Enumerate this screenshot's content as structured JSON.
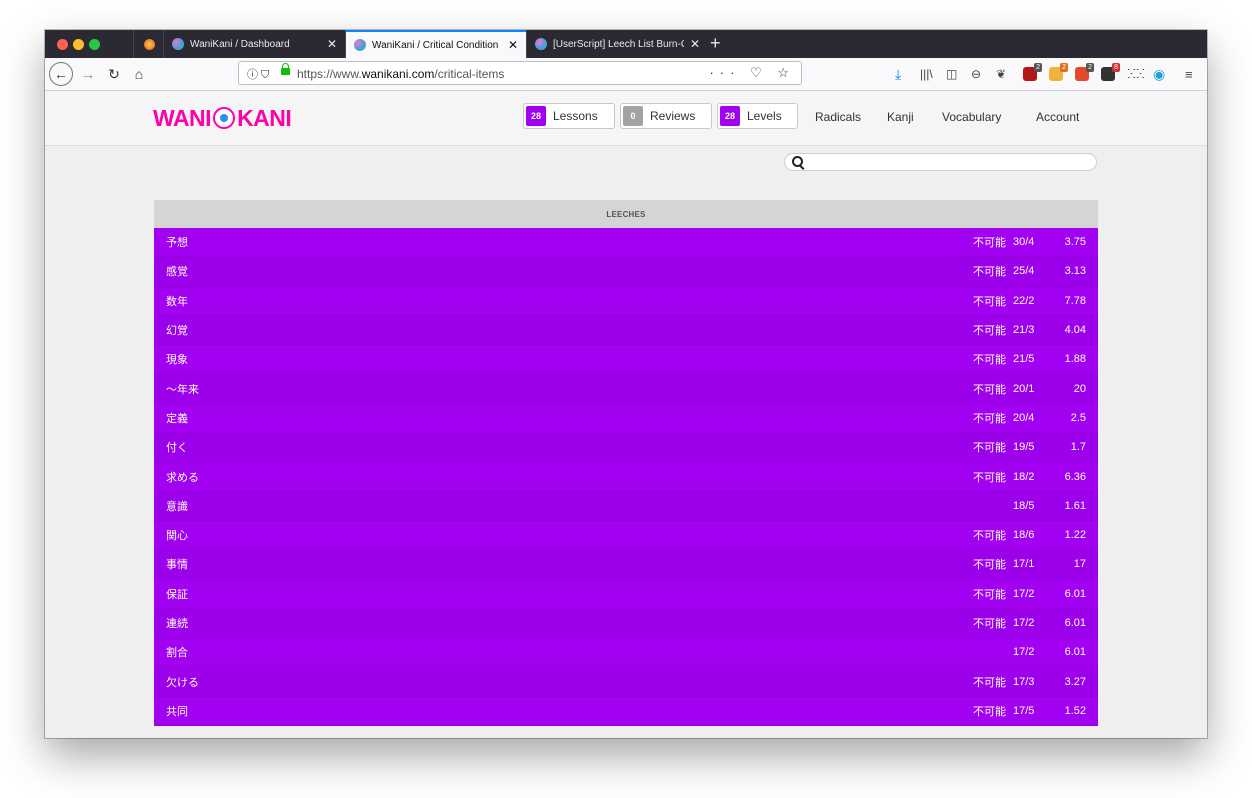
{
  "browser": {
    "tabs": [
      {
        "title": "WaniKani / Dashboard",
        "close": "✕"
      },
      {
        "title": "WaniKani / Critical Condition Ite",
        "close": "✕"
      },
      {
        "title": "[UserScript] Leech List Burn-O",
        "close": "✕"
      }
    ],
    "new_tab": "+",
    "url_info": "ⓘ ⛉",
    "url_prefix": "https://www.",
    "url_domain": "wanikani.com",
    "url_path": "/critical-items",
    "url_actions": "··· ♡ ☆",
    "badges": [
      "2",
      "2",
      "2",
      "8"
    ]
  },
  "site": {
    "logo_left": "WANI",
    "logo_right": "KANI",
    "lessons": {
      "count": "28",
      "label": "Lessons"
    },
    "reviews": {
      "count": "0",
      "label": "Reviews"
    },
    "levels": {
      "count": "28",
      "label": "Levels"
    },
    "nav": {
      "radicals": "Radicals",
      "kanji": "Kanji",
      "vocabulary": "Vocabulary",
      "account": "Account"
    },
    "search_placeholder": ""
  },
  "leeches": {
    "title": "LEECHES",
    "rows": [
      {
        "item": "予想",
        "status": "不可能",
        "score": "30/4",
        "ratio": "3.75"
      },
      {
        "item": "感覚",
        "status": "不可能",
        "score": "25/4",
        "ratio": "3.13"
      },
      {
        "item": "数年",
        "status": "不可能",
        "score": "22/2",
        "ratio": "7.78"
      },
      {
        "item": "幻覚",
        "status": "不可能",
        "score": "21/3",
        "ratio": "4.04"
      },
      {
        "item": "現象",
        "status": "不可能",
        "score": "21/5",
        "ratio": "1.88"
      },
      {
        "item": "〜年来",
        "status": "不可能",
        "score": "20/1",
        "ratio": "20"
      },
      {
        "item": "定義",
        "status": "不可能",
        "score": "20/4",
        "ratio": "2.5"
      },
      {
        "item": "付く",
        "status": "不可能",
        "score": "19/5",
        "ratio": "1.7"
      },
      {
        "item": "求める",
        "status": "不可能",
        "score": "18/2",
        "ratio": "6.36"
      },
      {
        "item": "意識",
        "status": "",
        "score": "18/5",
        "ratio": "1.61"
      },
      {
        "item": "関心",
        "status": "不可能",
        "score": "18/6",
        "ratio": "1.22"
      },
      {
        "item": "事情",
        "status": "不可能",
        "score": "17/1",
        "ratio": "17"
      },
      {
        "item": "保証",
        "status": "不可能",
        "score": "17/2",
        "ratio": "6.01"
      },
      {
        "item": "連続",
        "status": "不可能",
        "score": "17/2",
        "ratio": "6.01"
      },
      {
        "item": "割合",
        "status": "",
        "score": "17/2",
        "ratio": "6.01"
      },
      {
        "item": "欠ける",
        "status": "不可能",
        "score": "17/3",
        "ratio": "3.27"
      },
      {
        "item": "共同",
        "status": "不可能",
        "score": "17/5",
        "ratio": "1.52"
      }
    ]
  }
}
